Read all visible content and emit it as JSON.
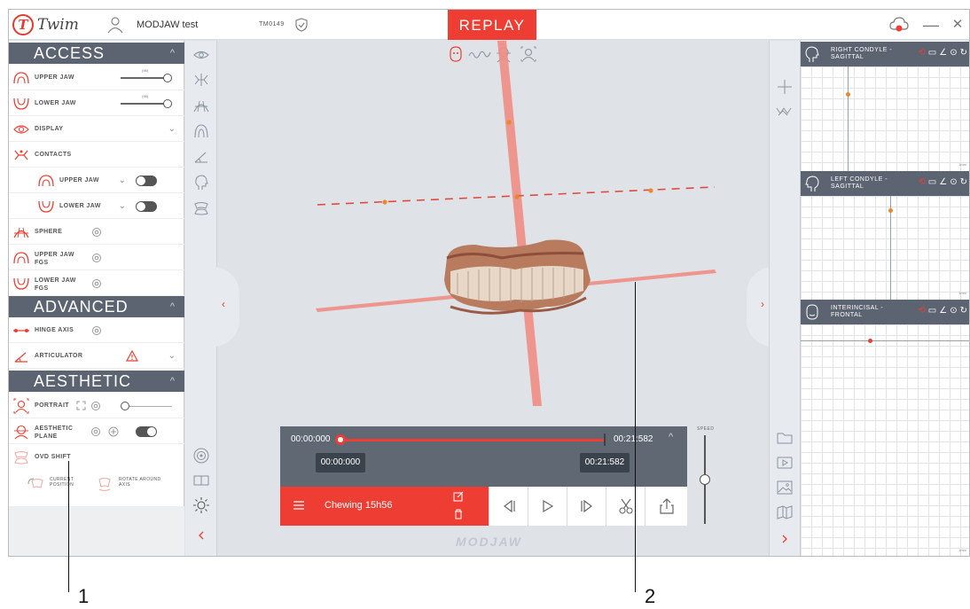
{
  "app": {
    "logo_letter": "T",
    "logo_text": "Twim",
    "patient_name": "MODJAW test",
    "patient_id": "TM0149",
    "mode_button": "REPLAY",
    "minimize": "—",
    "close": "✕"
  },
  "left_panel": {
    "access": {
      "title": "ACCESS",
      "upper_jaw": {
        "label": "UPPER JAW",
        "value": "(98)"
      },
      "lower_jaw": {
        "label": "LOWER JAW",
        "value": "(98)"
      },
      "display": {
        "label": "DISPLAY"
      },
      "contacts": {
        "label": "CONTACTS"
      },
      "contacts_upper": {
        "label": "UPPER JAW",
        "toggle": "off"
      },
      "contacts_lower": {
        "label": "LOWER JAW",
        "toggle": "off"
      },
      "sphere": {
        "label": "SPHERE"
      },
      "upper_jaw_fgs": {
        "label_line1": "UPPER JAW",
        "label_line2": "FGS"
      },
      "lower_jaw_fgs": {
        "label_line1": "LOWER JAW",
        "label_line2": "FGS"
      }
    },
    "advanced": {
      "title": "ADVANCED",
      "hinge_axis": {
        "label": "HINGE AXIS"
      },
      "articulator": {
        "label": "ARTICULATOR"
      }
    },
    "aesthetic": {
      "title": "AESTHETIC",
      "portrait": {
        "label": "PORTRAIT"
      },
      "aesthetic_plane": {
        "label_line1": "AESTHETIC",
        "label_line2": "PLANE",
        "toggle": "on"
      },
      "ovd_shift": {
        "label": "OVD SHIFT"
      },
      "current_position": {
        "label_line1": "CURRENT",
        "label_line2": "POSITION"
      },
      "rotate_around_axis": {
        "label_line1": "ROTATE AROUND",
        "label_line2": "AXIS"
      }
    }
  },
  "graphs": [
    {
      "title_line1": "RIGHT CONDYLE -",
      "title_line2": "SAGITTAL",
      "scale": "1mm"
    },
    {
      "title_line1": "LEFT CONDYLE -",
      "title_line2": "SAGITTAL",
      "scale": "1mm"
    },
    {
      "title_line1": "INTERINCISAL -",
      "title_line2": "FRONTAL",
      "scale": "1mm"
    }
  ],
  "player": {
    "time_start": "00:00:000",
    "time_end": "00:21:582",
    "tip_start": "00:00:000",
    "tip_end": "00:21:582",
    "progress": 0.0,
    "recording_name": "Chewing 15h56",
    "speed_label": "SPEED"
  },
  "watermark": "MODJAW",
  "callouts": {
    "one": "1",
    "two": "2"
  },
  "colors": {
    "accent": "#ee3e33",
    "panel_dark": "#5b6470",
    "axis": "#f08a80",
    "orange_point": "#e8892b"
  }
}
